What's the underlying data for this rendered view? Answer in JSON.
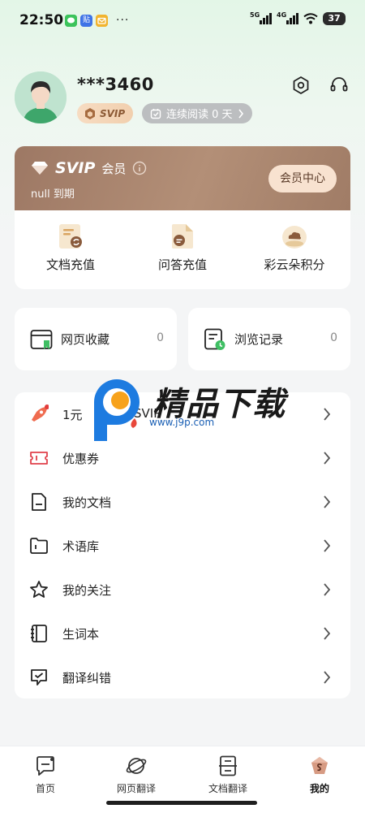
{
  "status_bar": {
    "time": "22:50",
    "notif_paste": "贴",
    "more": "···",
    "net_label_1": "5G",
    "net_label_2": "4G",
    "battery": "37"
  },
  "profile": {
    "username": "***3460",
    "svip_badge": "SVIP",
    "streak_label": "连续阅读 0 天"
  },
  "svip_card": {
    "title": "SVIP",
    "subtitle": "会员",
    "expire_text": "null 到期",
    "member_center_label": "会员中心",
    "actions": [
      {
        "label": "文档充值",
        "icon": "doc-recharge-icon"
      },
      {
        "label": "问答充值",
        "icon": "qa-recharge-icon"
      },
      {
        "label": "彩云朵积分",
        "icon": "cloud-points-icon"
      }
    ]
  },
  "quick_cards": {
    "favorites": {
      "label": "网页收藏",
      "count": "0"
    },
    "history": {
      "label": "浏览记录",
      "count": "0"
    }
  },
  "menu": {
    "items": [
      {
        "label": "1元",
        "label_tail": "SVIP",
        "icon": "rocket-icon"
      },
      {
        "label": "优惠券",
        "icon": "coupon-icon"
      },
      {
        "label": "我的文档",
        "icon": "document-icon"
      },
      {
        "label": "术语库",
        "icon": "folder-icon"
      },
      {
        "label": "我的关注",
        "icon": "star-icon"
      },
      {
        "label": "生词本",
        "icon": "notebook-icon"
      },
      {
        "label": "翻译纠错",
        "icon": "correction-icon"
      }
    ]
  },
  "watermark": {
    "text": "精品下载",
    "url": "www.j9p.com"
  },
  "tabbar": {
    "tabs": [
      {
        "label": "首页",
        "active": false
      },
      {
        "label": "网页翻译",
        "active": false
      },
      {
        "label": "文档翻译",
        "active": false
      },
      {
        "label": "我的",
        "active": true
      }
    ]
  },
  "colors": {
    "svip_gradient_start": "#9d7864",
    "accent_green": "#3fbf63",
    "badge_bg": "#f1cfae"
  }
}
